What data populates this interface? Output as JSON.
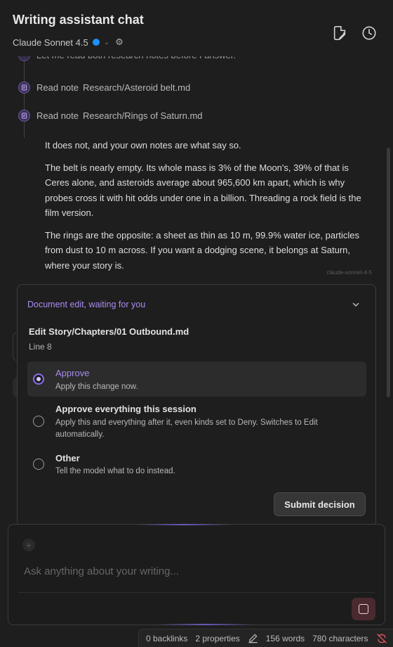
{
  "header": {
    "title": "Writing assistant chat",
    "model_name": "Claude Sonnet 4.5",
    "model_dot_color": "#1e90ff",
    "icons": [
      "file-edit-icon",
      "history-clock-icon",
      "gear-icon",
      "chevron-down-icon"
    ]
  },
  "thread": {
    "partial_step_text": "Let me read both research notes before I answer.",
    "steps": [
      {
        "action": "Read note",
        "path": "Research/Asteroid belt.md"
      },
      {
        "action": "Read note",
        "path": "Research/Rings of Saturn.md"
      }
    ],
    "answer": [
      "It does not, and your own notes are what say so.",
      "The belt is nearly empty. Its whole mass is 3% of the Moon's, 39% of that is Ceres alone, and asteroids average about 965,600 km apart, which is why probes cross it with hit odds under one in a billion. Threading a rock field is the film version.",
      "The rings are the opposite: a sheet as thin as 10 m, 99.9% water ice, particles from dust to 10 m across. If you want a dodging scene, it belongs at Saturn, where your story is."
    ],
    "model_tag": "claude-sonnet-4-5"
  },
  "edit_card": {
    "heading": "Document edit, waiting for you",
    "accent_color": "#a98cf0",
    "edit_title": "Edit Story/Chapters/01 Outbound.md",
    "edit_line": "Line 8",
    "options": [
      {
        "title": "Approve",
        "desc": "Apply this change now.",
        "selected": true
      },
      {
        "title": "Approve everything this session",
        "desc": "Apply this and everything after it, even kinds set to Deny. Switches to Edit automatically.",
        "selected": false
      },
      {
        "title": "Other",
        "desc": "Tell the model what to do instead.",
        "selected": false
      }
    ],
    "submit_label": "Submit decision"
  },
  "composer": {
    "placeholder": "Ask anything about your writing...",
    "value": ""
  },
  "status_bar": {
    "backlinks": "0 backlinks",
    "properties": "2 properties",
    "words": "156 words",
    "characters": "780 characters"
  }
}
